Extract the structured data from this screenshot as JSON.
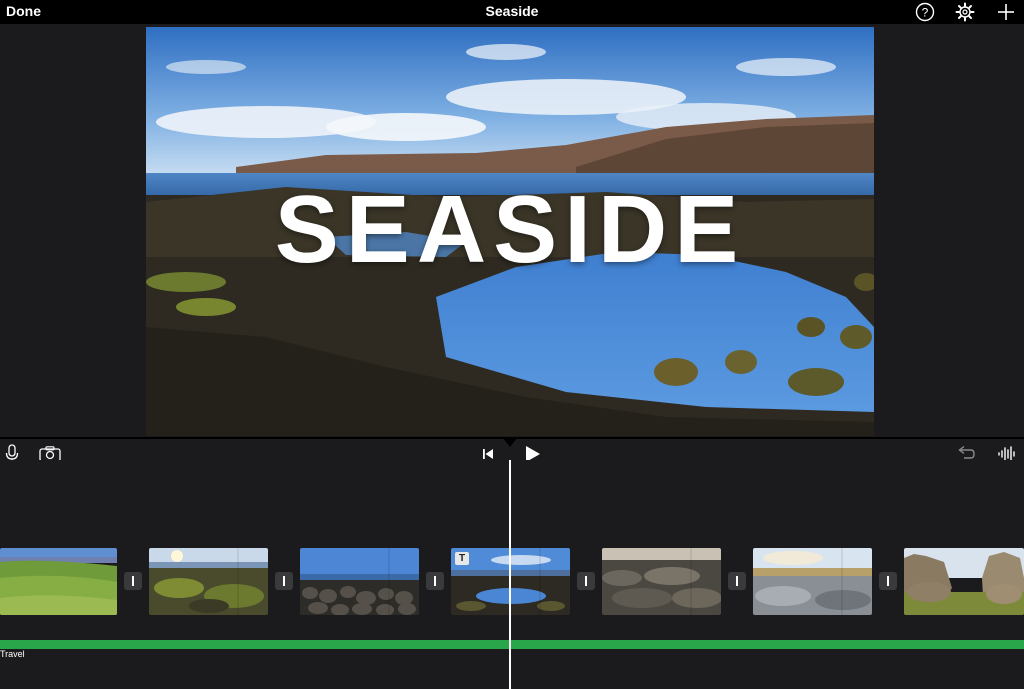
{
  "topbar": {
    "done_label": "Done",
    "title": "Seaside",
    "icons": [
      "help-icon",
      "settings-gear-icon",
      "add-plus-icon"
    ]
  },
  "preview": {
    "title_text": "SEASIDE"
  },
  "toolbar": {
    "left_icons": [
      "microphone-icon",
      "camera-icon"
    ],
    "center_icons": [
      "skip-to-start-icon",
      "play-icon"
    ],
    "right_icons": [
      "undo-icon",
      "audio-waveform-icon"
    ]
  },
  "timeline": {
    "clips": [
      {
        "name": "clip-1-green-hills",
        "has_title_badge": false
      },
      {
        "name": "clip-2-coastal-rocks",
        "has_title_badge": false
      },
      {
        "name": "clip-3-rocky-shore",
        "has_title_badge": false
      },
      {
        "name": "clip-4-tide-pool",
        "has_title_badge": true,
        "badge": "T"
      },
      {
        "name": "clip-5-wet-rocks",
        "has_title_badge": false
      },
      {
        "name": "clip-6-sunset-shore",
        "has_title_badge": false
      },
      {
        "name": "clip-7-rock-formations",
        "has_title_badge": false
      }
    ],
    "music_track_label": "Travel"
  },
  "colors": {
    "background": "#1b1b1d",
    "topbar": "#000000",
    "music_track": "#2aa64a",
    "playhead": "#ffffff"
  }
}
